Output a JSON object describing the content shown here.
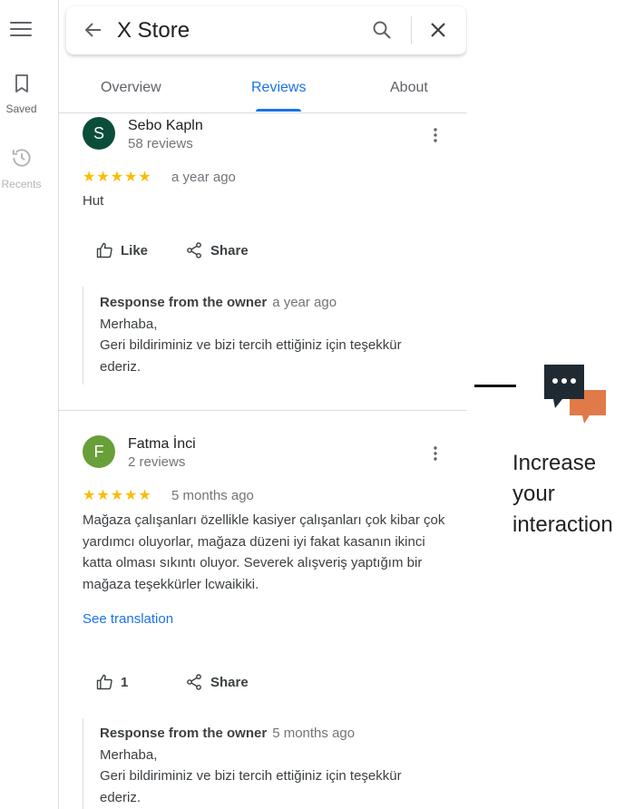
{
  "rail": {
    "saved_label": "Saved",
    "recents_label": "Recents"
  },
  "search": {
    "value": "X Store"
  },
  "tabs": [
    {
      "label": "Overview"
    },
    {
      "label": "Reviews",
      "active": true
    },
    {
      "label": "About"
    }
  ],
  "reviews": [
    {
      "initial": "S",
      "avatar_color": "#0b4d3b",
      "name": "Sebo Kapln",
      "count": "58 reviews",
      "stars": "★★★★★",
      "rating": 5,
      "date": "a year ago",
      "text": "Hut",
      "like_label": "Like",
      "share_label": "Share",
      "owner_title": "Response from the owner",
      "owner_date": "a year ago",
      "owner_line1": "Merhaba,",
      "owner_line2": "Geri bildiriminiz ve bizi tercih ettiğiniz için teşekkür ederiz."
    },
    {
      "initial": "F",
      "avatar_color": "#689f38",
      "name": "Fatma İnci",
      "count": "2 reviews",
      "stars": "★★★★★",
      "rating": 5,
      "date": "5 months ago",
      "text": "Mağaza çalışanları özellikle kasiyer çalışanları çok kibar çok yardımcı oluyorlar, mağaza düzeni iyi fakat kasanın ikinci katta olması sıkıntı oluyor. Severek alışveriş yaptığım bir mağaza teşekkürler lcwaikiki.",
      "translation_link": "See translation",
      "like_label": "1",
      "share_label": "Share",
      "owner_title": "Response from the owner",
      "owner_date": "5 months ago",
      "owner_line1": "Merhaba,",
      "owner_line2": "Geri bildiriminiz ve bizi tercih ettiğiniz için teşekkür ederiz."
    }
  ],
  "promo": {
    "text": "Increase your interaction",
    "colors": {
      "dark_bubble": "#1f2a33",
      "orange_bubble": "#e07a48"
    }
  },
  "colors": {
    "accent": "#1a73e8",
    "star": "#fbbc04"
  }
}
